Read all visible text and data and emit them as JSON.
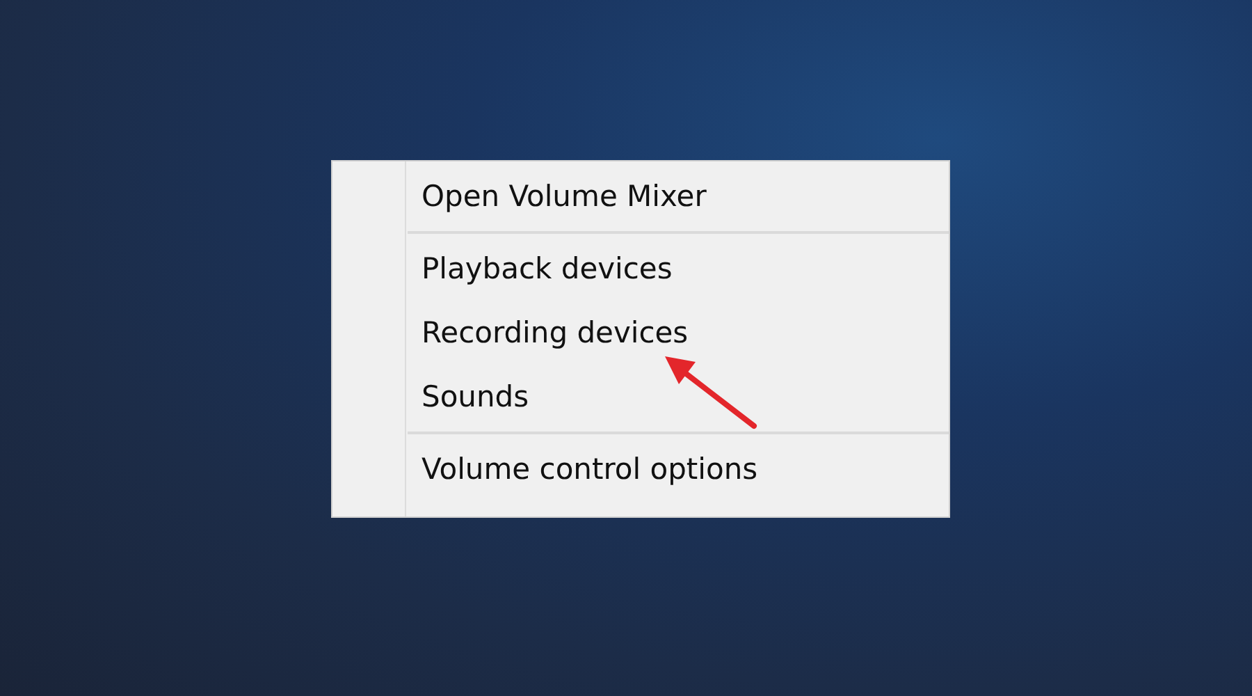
{
  "context_menu": {
    "sections": [
      {
        "items": [
          {
            "label": "Open Volume Mixer"
          }
        ]
      },
      {
        "items": [
          {
            "label": "Playback devices"
          },
          {
            "label": "Recording devices"
          },
          {
            "label": "Sounds"
          }
        ]
      },
      {
        "items": [
          {
            "label": "Volume control options"
          }
        ]
      }
    ]
  }
}
